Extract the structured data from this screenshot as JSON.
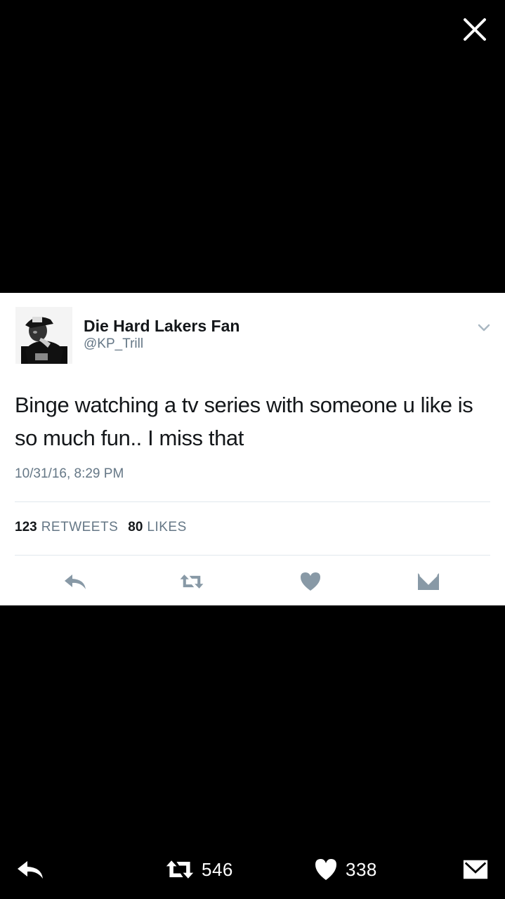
{
  "viewer": {
    "close_icon": "close-icon",
    "background_color": "#000000"
  },
  "tweet": {
    "display_name": "Die Hard Lakers Fan",
    "handle": "@KP_Trill",
    "text": "Binge watching a tv series with someone u like is so much fun.. I miss that",
    "timestamp": "10/31/16, 8:29 PM",
    "retweets_count": "123",
    "retweets_label": "RETWEETS",
    "likes_count": "80",
    "likes_label": "LIKES",
    "menu_icon": "chevron-down-icon"
  },
  "card_actions": [
    {
      "icon": "reply-icon"
    },
    {
      "icon": "retweet-icon"
    },
    {
      "icon": "heart-icon"
    },
    {
      "icon": "message-icon"
    }
  ],
  "bottom_bar": {
    "reply_icon": "reply-icon",
    "retweet_icon": "retweet-icon",
    "retweet_count": "546",
    "like_icon": "heart-icon",
    "like_count": "338",
    "message_icon": "message-icon"
  },
  "colors": {
    "text_primary": "#14171a",
    "text_secondary": "#657786",
    "icon_gray": "#8899a6",
    "divider": "#e1e8ed"
  }
}
